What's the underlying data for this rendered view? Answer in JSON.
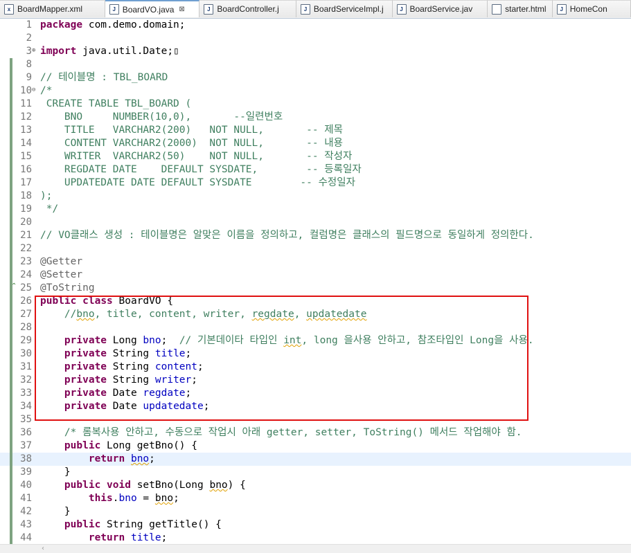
{
  "tabs": [
    {
      "label": "BoardMapper.xml",
      "icon": "xml-file-icon",
      "icon_glyph": "x"
    },
    {
      "label": "BoardVO.java",
      "icon": "java-file-icon",
      "icon_glyph": "J",
      "active": true,
      "close": "⊠"
    },
    {
      "label": "BoardController.j",
      "icon": "java-file-icon",
      "icon_glyph": "J"
    },
    {
      "label": "BoardServiceImpl.j",
      "icon": "java-file-icon",
      "icon_glyph": "J"
    },
    {
      "label": "BoardService.jav",
      "icon": "java-file-icon",
      "icon_glyph": "J"
    },
    {
      "label": "starter.html",
      "icon": "html-file-icon",
      "icon_glyph": ""
    },
    {
      "label": "HomeCon",
      "icon": "java-file-icon",
      "icon_glyph": "J"
    }
  ],
  "lines": [
    {
      "n": "1",
      "html": "<span class=\"kw\">package</span> com.demo.domain;"
    },
    {
      "n": "2",
      "html": ""
    },
    {
      "n": "3",
      "fold": "⊕",
      "html": "<span class=\"kw\">import</span> java.util.Date;▯"
    },
    {
      "n": "8",
      "mark": true,
      "html": ""
    },
    {
      "n": "9",
      "mark": true,
      "html": "<span class=\"cm\">// 테이블명 : TBL_BOARD</span>"
    },
    {
      "n": "10",
      "fold": "⊖",
      "mark": true,
      "html": "<span class=\"cm\">/*</span>"
    },
    {
      "n": "11",
      "mark": true,
      "html": "<span class=\"cm\"> CREATE TABLE TBL_BOARD (</span>"
    },
    {
      "n": "12",
      "mark": true,
      "html": "<span class=\"cm\">    BNO     NUMBER(10,0),       --일련번호</span>"
    },
    {
      "n": "13",
      "mark": true,
      "html": "<span class=\"cm\">    TITLE   VARCHAR2(200)   NOT NULL,       -- 제목</span>"
    },
    {
      "n": "14",
      "mark": true,
      "html": "<span class=\"cm\">    CONTENT VARCHAR2(2000)  NOT NULL,       -- 내용</span>"
    },
    {
      "n": "15",
      "mark": true,
      "html": "<span class=\"cm\">    WRITER  VARCHAR2(50)    NOT NULL,       -- 작성자</span>"
    },
    {
      "n": "16",
      "mark": true,
      "html": "<span class=\"cm\">    REGDATE DATE    DEFAULT SYSDATE,        -- 등록일자</span>"
    },
    {
      "n": "17",
      "mark": true,
      "html": "<span class=\"cm\">    UPDATEDATE DATE DEFAULT SYSDATE        -- 수정일자</span>"
    },
    {
      "n": "18",
      "mark": true,
      "html": "<span class=\"cm\">);</span>"
    },
    {
      "n": "19",
      "mark": true,
      "html": "<span class=\"cm\"> */</span>"
    },
    {
      "n": "20",
      "mark": true,
      "html": ""
    },
    {
      "n": "21",
      "mark": true,
      "html": "<span class=\"cm\">// VO클래스 생성 : 테이블명은 알맞은 이름을 정의하고, 컬럼명은 클래스의 필드명으로 동일하게 정의한다.</span>"
    },
    {
      "n": "22",
      "mark": true,
      "html": ""
    },
    {
      "n": "23",
      "mark": true,
      "html": "<span class=\"ann\">@Getter</span>"
    },
    {
      "n": "24",
      "mark": true,
      "html": "<span class=\"ann\">@Setter</span>"
    },
    {
      "n": "25",
      "mark": true,
      "html": "<span class=\"ann\">@ToString</span>"
    },
    {
      "n": "26",
      "mark": true,
      "html": "<span class=\"kw\">public</span> <span class=\"kw\">class</span> BoardVO {"
    },
    {
      "n": "27",
      "mark": true,
      "html": "    <span class=\"cm\">//<span class=\"sq\">bno</span>, title, content, writer, <span class=\"sq\">regdate</span>, <span class=\"sq\">updatedate</span></span>"
    },
    {
      "n": "28",
      "mark": true,
      "html": ""
    },
    {
      "n": "29",
      "mark": true,
      "html": "    <span class=\"kw\">private</span> Long <span class=\"fld\">bno</span>;  <span class=\"cm\">// 기본데이타 타입인 <span class=\"sq\">int</span>, long 을사용 안하고, 참조타입인 Long을 사용.</span>"
    },
    {
      "n": "30",
      "mark": true,
      "html": "    <span class=\"kw\">private</span> String <span class=\"fld\">title</span>;"
    },
    {
      "n": "31",
      "mark": true,
      "html": "    <span class=\"kw\">private</span> String <span class=\"fld\">content</span>;"
    },
    {
      "n": "32",
      "mark": true,
      "html": "    <span class=\"kw\">private</span> String <span class=\"fld\">writer</span>;"
    },
    {
      "n": "33",
      "mark": true,
      "html": "    <span class=\"kw\">private</span> Date <span class=\"fld\">regdate</span>;"
    },
    {
      "n": "34",
      "mark": true,
      "html": "    <span class=\"kw\">private</span> Date <span class=\"fld\">updatedate</span>;"
    },
    {
      "n": "35",
      "mark": true,
      "html": ""
    },
    {
      "n": "36",
      "mark": true,
      "html": "    <span class=\"cm\">/* 롬복사용 안하고, 수동으로 작업시 아래 getter, setter, ToString() 메서드 작업해야 함.</span>"
    },
    {
      "n": "37",
      "mark": true,
      "html": "    <span class=\"kw\">public</span> Long getBno() {"
    },
    {
      "n": "38",
      "mark": true,
      "cur": true,
      "html": "        <span class=\"kw\">return</span> <span class=\"fld sq\">bno</span>;"
    },
    {
      "n": "39",
      "mark": true,
      "html": "    }"
    },
    {
      "n": "40",
      "mark": true,
      "html": "    <span class=\"kw\">public</span> <span class=\"kw\">void</span> setBno(Long <span class=\"sq\">bno</span>) {"
    },
    {
      "n": "41",
      "mark": true,
      "html": "        <span class=\"kw\">this</span>.<span class=\"fld\">bno</span> = <span class=\"sq\">bno</span>;"
    },
    {
      "n": "42",
      "mark": true,
      "html": "    }"
    },
    {
      "n": "43",
      "mark": true,
      "html": "    <span class=\"kw\">public</span> String getTitle() {"
    },
    {
      "n": "44",
      "mark": true,
      "html": "        <span class=\"kw\">return</span> <span class=\"fld\">title</span>;"
    }
  ]
}
